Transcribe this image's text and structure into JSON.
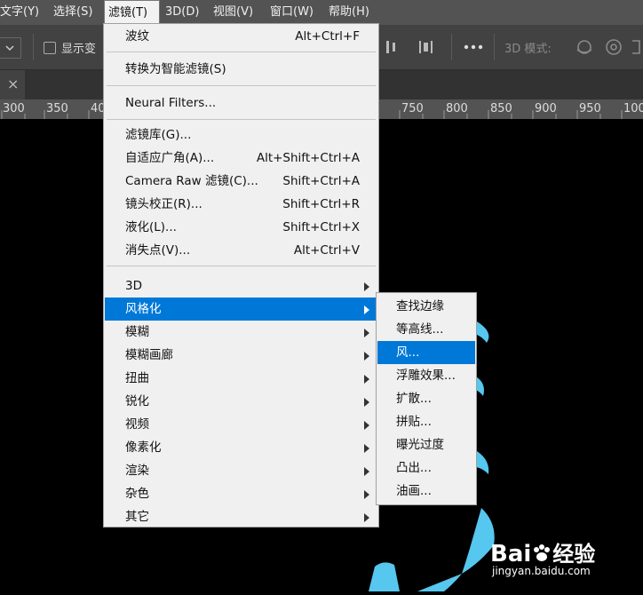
{
  "menubar": {
    "items": [
      {
        "label": "文字(Y)"
      },
      {
        "label": "选择(S)"
      },
      {
        "label": "滤镜(T)"
      },
      {
        "label": "3D(D)"
      },
      {
        "label": "视图(V)"
      },
      {
        "label": "窗口(W)"
      },
      {
        "label": "帮助(H)"
      }
    ]
  },
  "options": {
    "show_transform": "显示变",
    "mode_3d": "3D 模式:"
  },
  "ruler": {
    "ticks": [
      "300",
      "350",
      "40",
      "750",
      "800",
      "850",
      "900",
      "950",
      "100"
    ]
  },
  "filter_menu": {
    "group1": [
      {
        "label": "波纹",
        "shortcut": "Alt+Ctrl+F"
      }
    ],
    "group2": [
      {
        "label": "转换为智能滤镜(S)"
      }
    ],
    "group3": [
      {
        "label": "Neural Filters..."
      }
    ],
    "group4": [
      {
        "label": "滤镜库(G)...",
        "shortcut": ""
      },
      {
        "label": "自适应广角(A)...",
        "shortcut": "Alt+Shift+Ctrl+A"
      },
      {
        "label": "Camera Raw 滤镜(C)...",
        "shortcut": "Shift+Ctrl+A"
      },
      {
        "label": "镜头校正(R)...",
        "shortcut": "Shift+Ctrl+R"
      },
      {
        "label": "液化(L)...",
        "shortcut": "Shift+Ctrl+X"
      },
      {
        "label": "消失点(V)...",
        "shortcut": "Alt+Ctrl+V"
      }
    ],
    "group5": [
      {
        "label": "3D"
      },
      {
        "label": "风格化"
      },
      {
        "label": "模糊"
      },
      {
        "label": "模糊画廊"
      },
      {
        "label": "扭曲"
      },
      {
        "label": "锐化"
      },
      {
        "label": "视频"
      },
      {
        "label": "像素化"
      },
      {
        "label": "渲染"
      },
      {
        "label": "杂色"
      },
      {
        "label": "其它"
      }
    ]
  },
  "stylize_submenu": {
    "items": [
      {
        "label": "查找边缘"
      },
      {
        "label": "等高线..."
      },
      {
        "label": "风..."
      },
      {
        "label": "浮雕效果..."
      },
      {
        "label": "扩散..."
      },
      {
        "label": "拼贴..."
      },
      {
        "label": "曝光过度"
      },
      {
        "label": "凸出..."
      },
      {
        "label": "油画..."
      }
    ]
  },
  "watermark": {
    "brand": "Bai",
    "brand_cn": "经验",
    "url": "jingyan.baidu.com"
  },
  "colors": {
    "highlight": "#0078d7",
    "menu_bg": "#f0f0f0",
    "accent_shape": "#56c7ee"
  }
}
